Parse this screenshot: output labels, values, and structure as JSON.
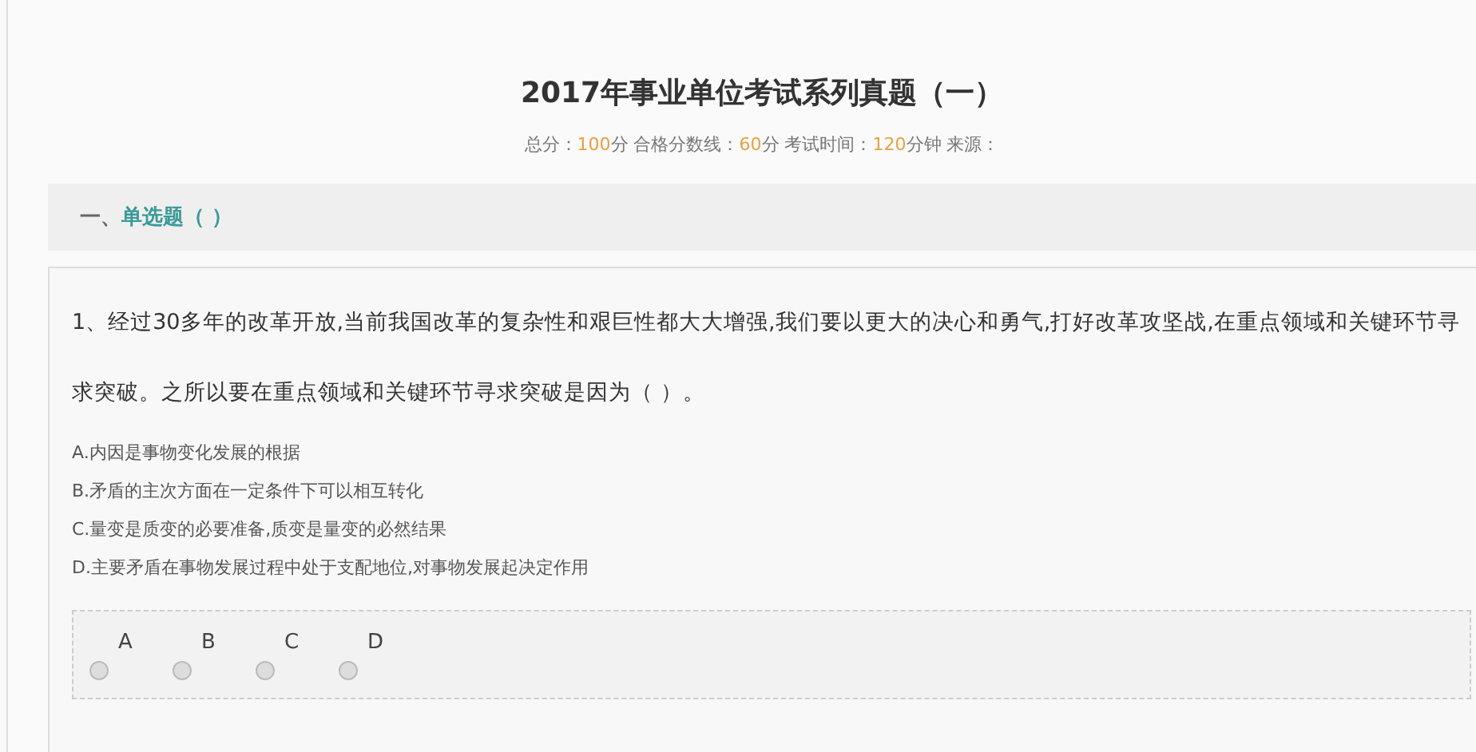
{
  "title": "2017年事业单位考试系列真题（一）",
  "meta": [
    {
      "kind": "label",
      "text": "总分："
    },
    {
      "kind": "value",
      "text": "100"
    },
    {
      "kind": "label",
      "text": "分 合格分数线："
    },
    {
      "kind": "value",
      "text": "60"
    },
    {
      "kind": "label",
      "text": "分 考试时间："
    },
    {
      "kind": "value",
      "text": "120"
    },
    {
      "kind": "label",
      "text": "分钟 来源："
    }
  ],
  "section": {
    "number": "一、",
    "title": "单选题（ ）"
  },
  "question": {
    "text": "1、经过30多年的改革开放,当前我国改革的复杂性和艰巨性都大大增强,我们要以更大的决心和勇气,打好改革攻坚战,在重点领域和关键环节寻求突破。之所以要在重点领域和关键环节寻求突破是因为（ ）。",
    "options": [
      "A.内因是事物变化发展的根据",
      "B.矛盾的主次方面在一定条件下可以相互转化",
      "C.量变是质变的必要准备,质变是量变的必然结果",
      "D.主要矛盾在事物发展过程中处于支配地位,对事物发展起决定作用"
    ],
    "answers": [
      {
        "letter": "A",
        "selected": false
      },
      {
        "letter": "B",
        "selected": false
      },
      {
        "letter": "C",
        "selected": false
      },
      {
        "letter": "D",
        "selected": false
      }
    ]
  }
}
